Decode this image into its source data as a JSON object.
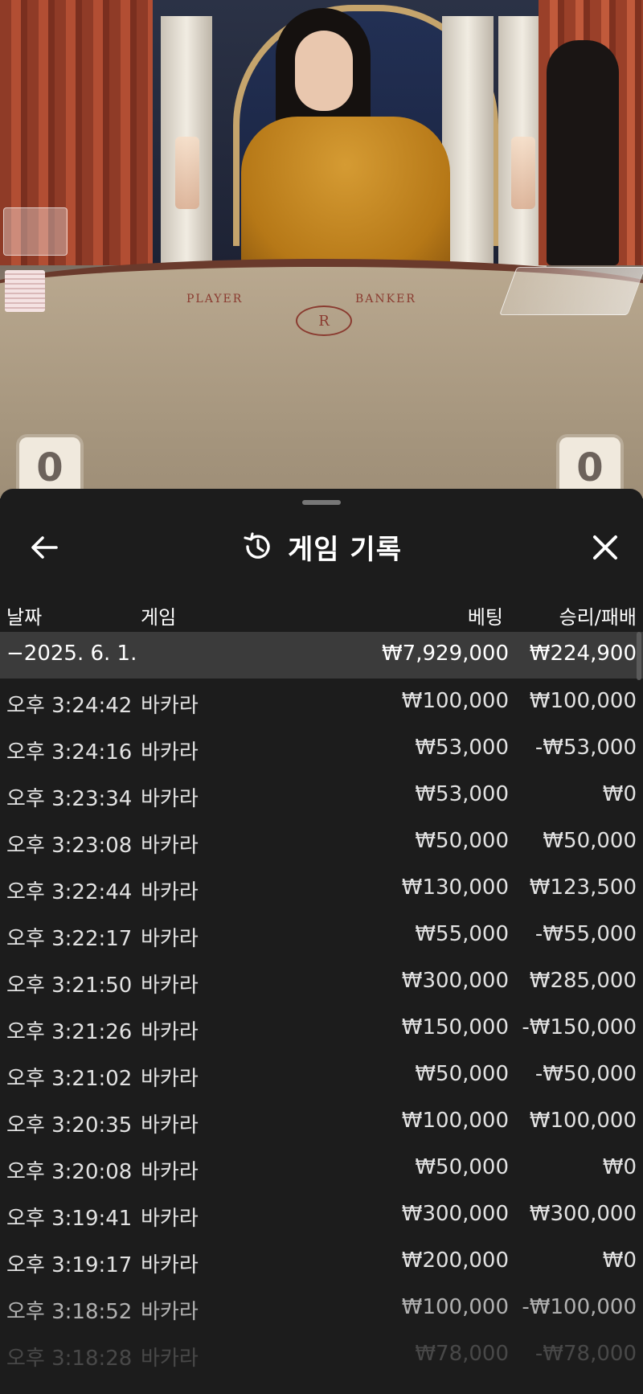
{
  "scene": {
    "felt_player": "PLAYER",
    "felt_banker": "BANKER",
    "crest_letter": "R",
    "player_score": "0",
    "banker_score": "0"
  },
  "sheet": {
    "title": "게임 기록",
    "title_icon": "history-icon",
    "back_icon": "arrow-left-icon",
    "close_icon": "close-icon",
    "columns": {
      "date": "날짜",
      "game": "게임",
      "bet": "베팅",
      "result": "승리/패배"
    },
    "summary": {
      "date": "−2025. 6. 1.",
      "bet": "₩7,929,000",
      "result": "₩224,900"
    },
    "rows": [
      {
        "time": "오후 3:24:42",
        "game": "바카라",
        "bet": "₩100,000",
        "result": "₩100,000"
      },
      {
        "time": "오후 3:24:16",
        "game": "바카라",
        "bet": "₩53,000",
        "result": "-₩53,000"
      },
      {
        "time": "오후 3:23:34",
        "game": "바카라",
        "bet": "₩53,000",
        "result": "₩0"
      },
      {
        "time": "오후 3:23:08",
        "game": "바카라",
        "bet": "₩50,000",
        "result": "₩50,000"
      },
      {
        "time": "오후 3:22:44",
        "game": "바카라",
        "bet": "₩130,000",
        "result": "₩123,500"
      },
      {
        "time": "오후 3:22:17",
        "game": "바카라",
        "bet": "₩55,000",
        "result": "-₩55,000"
      },
      {
        "time": "오후 3:21:50",
        "game": "바카라",
        "bet": "₩300,000",
        "result": "₩285,000"
      },
      {
        "time": "오후 3:21:26",
        "game": "바카라",
        "bet": "₩150,000",
        "result": "-₩150,000"
      },
      {
        "time": "오후 3:21:02",
        "game": "바카라",
        "bet": "₩50,000",
        "result": "-₩50,000"
      },
      {
        "time": "오후 3:20:35",
        "game": "바카라",
        "bet": "₩100,000",
        "result": "₩100,000"
      },
      {
        "time": "오후 3:20:08",
        "game": "바카라",
        "bet": "₩50,000",
        "result": "₩0"
      },
      {
        "time": "오후 3:19:41",
        "game": "바카라",
        "bet": "₩300,000",
        "result": "₩300,000"
      },
      {
        "time": "오후 3:19:17",
        "game": "바카라",
        "bet": "₩200,000",
        "result": "₩0"
      },
      {
        "time": "오후 3:18:52",
        "game": "바카라",
        "bet": "₩100,000",
        "result": "-₩100,000"
      },
      {
        "time": "오후 3:18:28",
        "game": "바카라",
        "bet": "₩78,000",
        "result": "-₩78,000"
      }
    ]
  }
}
